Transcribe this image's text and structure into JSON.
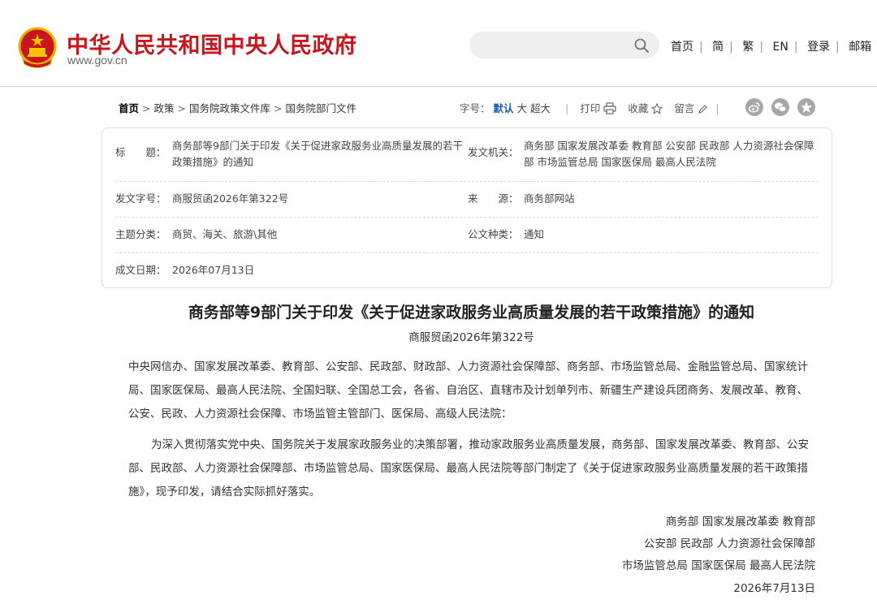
{
  "site": {
    "title": "中华人民共和国中央人民政府",
    "url": "www.gov.cn",
    "emblem_icon": "national-emblem-icon",
    "brand_color": "#c8161d"
  },
  "search": {
    "placeholder": "",
    "icon": "search-icon"
  },
  "top_nav": [
    "首页",
    "简",
    "繁",
    "EN",
    "登录",
    "邮箱"
  ],
  "breadcrumb": [
    "首页",
    "政策",
    "国务院政策文件库",
    "国务院部门文件"
  ],
  "toolbar": {
    "font_size_label": "字号：",
    "font_sizes": [
      "默认",
      "大",
      "超大"
    ],
    "active_font_size": "默认",
    "print": "打印",
    "favorite": "收藏",
    "comment": "留言",
    "share_icons": [
      "weibo-icon",
      "wechat-icon",
      "qzone-star-icon"
    ]
  },
  "info": {
    "title_label": "标　　题：",
    "title_value": "商务部等9部门关于印发《关于促进家政服务业高质量发展的若干政策措施》的通知",
    "issuer_label": "发文机关：",
    "issuer_value": "商务部 国家发展改革委 教育部 公安部 民政部 人力资源社会保障部 市场监管总局 国家医保局 最高人民法院",
    "doc_no_label": "发文字号：",
    "doc_no_value": "商服贸函2026年第322号",
    "source_label": "来　　源：",
    "source_value": "商务部网站",
    "topic_label": "主题分类：",
    "topic_value": "商贸、海关、旅游\\其他",
    "doc_type_label": "公文种类：",
    "doc_type_value": "通知",
    "date_label": "成文日期：",
    "date_value": "2026年07月13日"
  },
  "document": {
    "title": "商务部等9部门关于印发《关于促进家政服务业高质量发展的若干政策措施》的通知",
    "number": "商服贸函2026年第322号",
    "recipients": "中央网信办、国家发展改革委、教育部、公安部、民政部、财政部、人力资源社会保障部、商务部、市场监管总局、金融监管总局、国家统计局、国家医保局、最高人民法院、全国妇联、全国总工会，各省、自治区、直辖市及计划单列市、新疆生产建设兵团商务、发展改革、教育、公安、民政、人力资源社会保障、市场监管主管部门、医保局、高级人民法院：",
    "body": "为深入贯彻落实党中央、国务院关于发展家政服务业的决策部署，推动家政服务业高质量发展，商务部、国家发展改革委、教育部、公安部、民政部、人力资源社会保障部、市场监管总局、国家医保局、最高人民法院等部门制定了《关于促进家政服务业高质量发展的若干政策措施》，现予印发，请结合实际抓好落实。",
    "signatories": [
      "商务部 国家发展改革委 教育部",
      "公安部 民政部 人力资源社会保障部",
      "市场监管总局 国家医保局 最高人民法院"
    ],
    "sign_date": "2026年7月13日"
  }
}
